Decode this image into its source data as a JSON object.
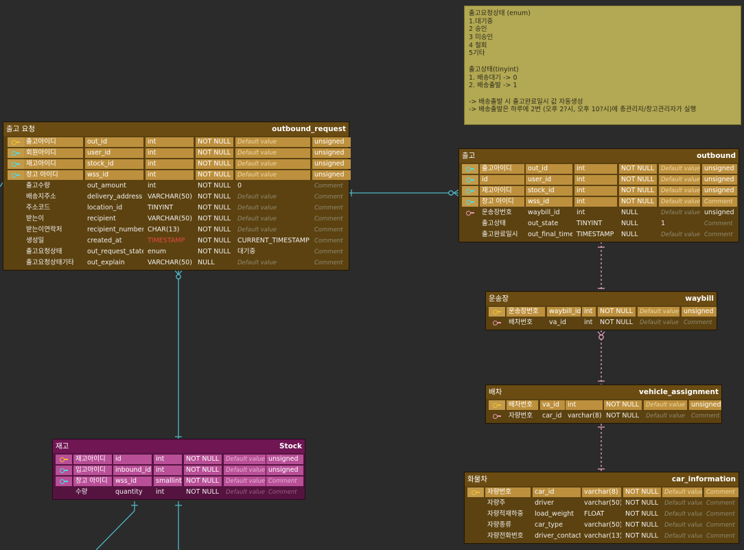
{
  "note": {
    "lines": [
      "출고요청상태 (enum)",
      "1.대기중",
      "2 승인",
      "3 미승인",
      "4 철회",
      "5기타",
      "",
      "출고상태(tinyint)",
      "1. 배송대기 -> 0",
      "2. 배송출발 -> 1",
      "",
      "-> 배송출발 시 출고완료일시 값 자동생성",
      "-> 배송출발은 하루에 2번 (오후 2?시, 오후 10?시)에 총관리자/창고관리자가 실행"
    ]
  },
  "tables": {
    "outbound_request": {
      "title_kor": "출고 요청",
      "title_eng": "outbound_request",
      "rows": [
        {
          "key": "gold",
          "pk": true,
          "kor": "출고아이디",
          "col": "out_id",
          "type": "int",
          "null": "NOT NULL",
          "def": "Default value",
          "extra": "unsigned"
        },
        {
          "key": "cyan",
          "pk": true,
          "kor": "회원아이디",
          "col": "user_id",
          "type": "int",
          "null": "NOT NULL",
          "def": "Default value",
          "extra": "unsigned"
        },
        {
          "key": "cyan",
          "pk": true,
          "kor": "재고아이디",
          "col": "stock_id",
          "type": "int",
          "null": "NOT NULL",
          "def": "Default value",
          "extra": "unsigned"
        },
        {
          "key": "cyan",
          "pk": true,
          "kor": "창고 아이디",
          "col": "wss_id",
          "type": "int",
          "null": "NOT NULL",
          "def": "Default value",
          "extra": "unsigned"
        },
        {
          "key": "",
          "pk": false,
          "kor": "출고수량",
          "col": "out_amount",
          "type": "int",
          "null": "NOT NULL",
          "def": "0",
          "extra": "Comment"
        },
        {
          "key": "",
          "pk": false,
          "kor": "배송지주소",
          "col": "delivery_address",
          "type": "VARCHAR(50)",
          "null": "NOT NULL",
          "def": "Default value",
          "extra": "Comment"
        },
        {
          "key": "",
          "pk": false,
          "kor": "주소코드",
          "col": "location_id",
          "type": "TINYINT",
          "null": "NOT NULL",
          "def": "Default value",
          "extra": "Comment"
        },
        {
          "key": "",
          "pk": false,
          "kor": "받는이",
          "col": "recipient",
          "type": "VARCHAR(50)",
          "null": "NOT NULL",
          "def": "Default value",
          "extra": "Comment"
        },
        {
          "key": "",
          "pk": false,
          "kor": "받는이연락처",
          "col": "recipient_number",
          "type": "CHAR(13)",
          "null": "NOT NULL",
          "def": "Default value",
          "extra": "Comment"
        },
        {
          "key": "",
          "pk": false,
          "kor": "생성일",
          "col": "created_at",
          "type": "TIMESTAMP",
          "null": "NOT NULL",
          "def": "CURRENT_TIMESTAMP",
          "extra": "Comment"
        },
        {
          "key": "",
          "pk": false,
          "kor": "출고요청상태",
          "col": "out_request_state",
          "type": "enum",
          "null": "NOT NULL",
          "def": "대기중",
          "extra": "Comment"
        },
        {
          "key": "",
          "pk": false,
          "kor": "출고요청상태기타",
          "col": "out_explain",
          "type": "VARCHAR(50)",
          "null": "NULL",
          "def": "Default value",
          "extra": "Comment"
        }
      ]
    },
    "outbound": {
      "title_kor": "출고",
      "title_eng": "outbound",
      "rows": [
        {
          "key": "cyan",
          "pk": true,
          "kor": "출고아이디",
          "col": "out_id",
          "type": "int",
          "null": "NOT NULL",
          "def": "Default value",
          "extra": "unsigned"
        },
        {
          "key": "cyan",
          "pk": true,
          "kor": "id",
          "col": "user_id",
          "type": "int",
          "null": "NOT NULL",
          "def": "Default value",
          "extra": "unsigned"
        },
        {
          "key": "cyan",
          "pk": true,
          "kor": "재고아이디",
          "col": "stock_id",
          "type": "int",
          "null": "NOT NULL",
          "def": "Default value",
          "extra": "unsigned"
        },
        {
          "key": "cyan",
          "pk": true,
          "kor": "창고 아이디",
          "col": "wss_id",
          "type": "int",
          "null": "NOT NULL",
          "def": "Default value",
          "extra": "Comment"
        },
        {
          "key": "pink",
          "pk": false,
          "kor": "운송장번호",
          "col": "waybill_id",
          "type": "int",
          "null": "NULL",
          "def": "Default value",
          "extra": "unsigned"
        },
        {
          "key": "",
          "pk": false,
          "kor": "출고상태",
          "col": "out_state",
          "type": "TINYINT",
          "null": "NULL",
          "def": "1",
          "extra": "Comment"
        },
        {
          "key": "",
          "pk": false,
          "kor": "출고완료일시",
          "col": "out_final_time",
          "type": "TIMESTAMP",
          "null": "NULL",
          "def": "Default value",
          "extra": "Comment"
        }
      ]
    },
    "waybill": {
      "title_kor": "운송장",
      "title_eng": "waybill",
      "rows": [
        {
          "key": "gold",
          "pk": true,
          "kor": "운송장번호",
          "col": "waybill_id",
          "type": "int",
          "null": "NOT NULL",
          "def": "Default value",
          "extra": "unsigned"
        },
        {
          "key": "pink",
          "pk": false,
          "kor": "배차번호",
          "col": "va_id",
          "type": "int",
          "null": "NOT NULL",
          "def": "Default value",
          "extra": "Comment"
        }
      ]
    },
    "vehicle_assignment": {
      "title_kor": "배차",
      "title_eng": "vehicle_assignment",
      "rows": [
        {
          "key": "gold",
          "pk": true,
          "kor": "배차번호",
          "col": "va_id",
          "type": "int",
          "null": "NOT NULL",
          "def": "Default value",
          "extra": "unsigned"
        },
        {
          "key": "pink",
          "pk": false,
          "kor": "자량번호",
          "col": "car_id",
          "type": "varchar(8)",
          "null": "NOT NULL",
          "def": "Default value",
          "extra": "Comment"
        }
      ]
    },
    "stock": {
      "title_kor": "재고",
      "title_eng": "Stock",
      "rows": [
        {
          "key": "gold",
          "pk": true,
          "kor": "재고아이디",
          "col": "id",
          "type": "int",
          "null": "NOT NULL",
          "def": "Default value",
          "extra": "unsigned"
        },
        {
          "key": "cyan",
          "pk": true,
          "kor": "입고아이디",
          "col": "inbound_id",
          "type": "int",
          "null": "NOT NULL",
          "def": "Default value",
          "extra": "unsigned"
        },
        {
          "key": "cyan",
          "pk": true,
          "kor": "창고 아이디",
          "col": "wss_id",
          "type": "smallint",
          "null": "NOT NULL",
          "def": "Default value",
          "extra": "Comment"
        },
        {
          "key": "",
          "pk": false,
          "kor": "수량",
          "col": "quantity",
          "type": "int",
          "null": "NOT NULL",
          "def": "Default value",
          "extra": "Comment"
        }
      ]
    },
    "car_information": {
      "title_kor": "화물차",
      "title_eng": "car_information",
      "rows": [
        {
          "key": "gold",
          "pk": true,
          "kor": "자량번호",
          "col": "car_id",
          "type": "varchar(8)",
          "null": "NOT NULL",
          "def": "Default value",
          "extra": "Comment"
        },
        {
          "key": "",
          "pk": false,
          "kor": "자량주",
          "col": "driver",
          "type": "varchar(50)",
          "null": "NOT NULL",
          "def": "Default value",
          "extra": "Comment"
        },
        {
          "key": "",
          "pk": false,
          "kor": "자량적재하중",
          "col": "load_weight",
          "type": "FLOAT",
          "null": "NOT NULL",
          "def": "Default value",
          "extra": "Comment"
        },
        {
          "key": "",
          "pk": false,
          "kor": "자량종류",
          "col": "car_type",
          "type": "varchar(50)",
          "null": "NOT NULL",
          "def": "Default value",
          "extra": "Comment"
        },
        {
          "key": "",
          "pk": false,
          "kor": "자량전화번호",
          "col": "driver_contact",
          "type": "varchar(13)",
          "null": "NOT NULL",
          "def": "Default value",
          "extra": "Comment"
        }
      ]
    }
  },
  "colors": {
    "relation_cyan": "#4fb8c8",
    "relation_pink": "#e7a6bf",
    "timestamp_red": "#e24a3f"
  }
}
